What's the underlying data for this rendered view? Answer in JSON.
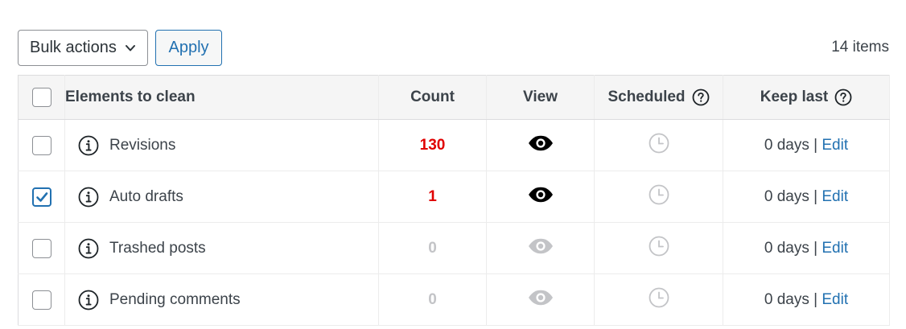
{
  "toolbar": {
    "bulk_actions_label": "Bulk actions",
    "apply_label": "Apply",
    "items_count": "14 items"
  },
  "table": {
    "headers": {
      "elements": "Elements to clean",
      "count": "Count",
      "view": "View",
      "scheduled": "Scheduled",
      "keep_last": "Keep last"
    },
    "rows": [
      {
        "name": "Revisions",
        "count": "130",
        "count_state": "red",
        "view_active": true,
        "checked": false,
        "keep_value": "0 days",
        "separator": "|",
        "edit_label": "Edit"
      },
      {
        "name": "Auto drafts",
        "count": "1",
        "count_state": "red",
        "view_active": true,
        "checked": true,
        "keep_value": "0 days",
        "separator": "|",
        "edit_label": "Edit"
      },
      {
        "name": "Trashed posts",
        "count": "0",
        "count_state": "grey",
        "view_active": false,
        "checked": false,
        "keep_value": "0 days",
        "separator": "|",
        "edit_label": "Edit"
      },
      {
        "name": "Pending comments",
        "count": "0",
        "count_state": "grey",
        "view_active": false,
        "checked": false,
        "keep_value": "0 days",
        "separator": "|",
        "edit_label": "Edit"
      }
    ]
  },
  "colors": {
    "accent": "#2271b1",
    "count_red": "#e00000",
    "muted": "#c3c4c7"
  },
  "icons": {
    "select_chevron": "chevron-down-icon",
    "info": "info-icon",
    "help": "question-help-icon",
    "view": "eye-icon",
    "scheduled": "clock-icon"
  }
}
